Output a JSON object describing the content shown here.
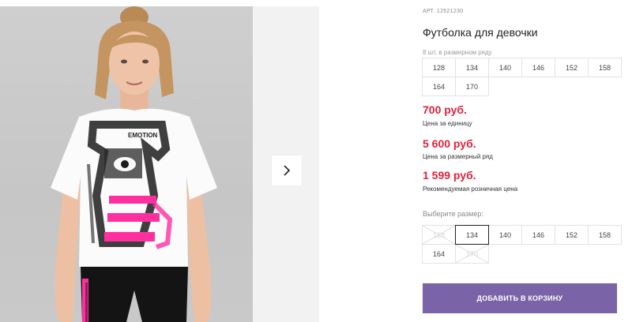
{
  "gallery": {
    "next_icon": "chevron-right-icon"
  },
  "product": {
    "article": "АРТ. 12521230",
    "title": "Футболка для девочки",
    "row_note": "8 шт. в размерном ряду",
    "row_sizes": [
      "128",
      "134",
      "140",
      "146",
      "152",
      "158",
      "164",
      "170"
    ],
    "prices": [
      {
        "value": "700 руб.",
        "note": "Цена за единицу"
      },
      {
        "value": "5 600 руб.",
        "note": "Цена за размерный ряд"
      },
      {
        "value": "1 599 руб.",
        "note": "Рекомендуемая розничная цена"
      }
    ],
    "choose_label": "Выберите размер:",
    "pick_sizes": [
      {
        "label": "128",
        "available": false
      },
      {
        "label": "134",
        "available": true,
        "selected": true
      },
      {
        "label": "140",
        "available": true
      },
      {
        "label": "146",
        "available": true
      },
      {
        "label": "152",
        "available": true
      },
      {
        "label": "158",
        "available": true
      },
      {
        "label": "164",
        "available": true
      },
      {
        "label": "170",
        "available": false
      }
    ],
    "cart_button": "ДОБАВИТЬ В КОРЗИНУ"
  },
  "colors": {
    "price": "#e2203a",
    "accent_button": "#7b63a8"
  }
}
